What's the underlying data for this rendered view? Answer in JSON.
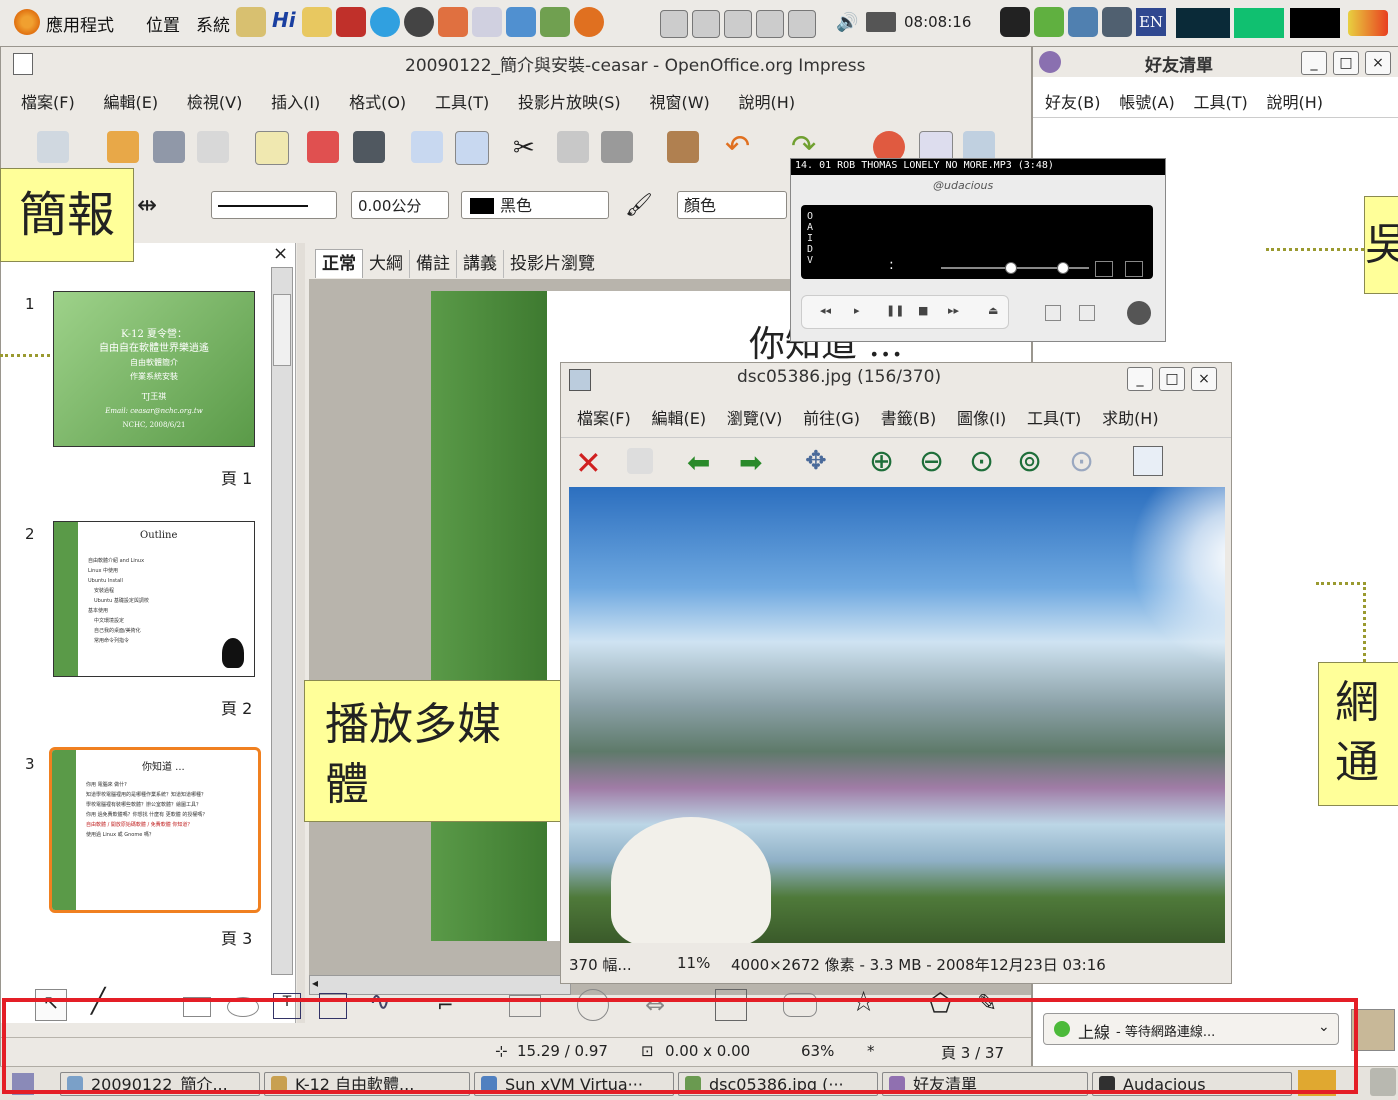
{
  "topbar": {
    "menus": [
      "應用程式",
      "位置",
      "系統"
    ],
    "clock": "08:08:16",
    "lang_badge": "EN"
  },
  "impress": {
    "title": "20090122_簡介與安裝-ceasar - OpenOffice.org Impress",
    "menus": [
      "檔案(F)",
      "編輯(E)",
      "檢視(V)",
      "插入(I)",
      "格式(O)",
      "工具(T)",
      "投影片放映(S)",
      "視窗(W)",
      "說明(H)"
    ],
    "line_width": "0.00公分",
    "line_color": "黑色",
    "fill_label": "顏色",
    "tabs": [
      "正常",
      "大綱",
      "備註",
      "講義",
      "投影片瀏覽"
    ],
    "slide_heading": "你知道 ...",
    "slides": [
      {
        "num": "1",
        "page": "頁 1",
        "title": "K-12 夏令營：",
        "subtitle": "自由自在軟體世界樂逍遙",
        "line3": "自由軟體簡介",
        "line4": "作業系統安裝",
        "author": "TJ王祺",
        "email": "Email: ceasar@nchc.org.tw",
        "org": "NCHC, 2008/6/21"
      },
      {
        "num": "2",
        "page": "頁 2",
        "title": "Outline",
        "bullets": [
          "自由軟體介紹 and Linux",
          "Linux 中使用",
          "Ubuntu Install",
          "安裝過程",
          "Ubuntu 基礎設定與調校",
          "基本使用",
          "中文環境設定",
          "自己我的桌面/美術化",
          "常用命令列指令"
        ]
      },
      {
        "num": "3",
        "page": "頁 3",
        "title": "你知道 ...",
        "bullets": [
          "你用 電腦來 做什?",
          "知道學校電腦裡用的是哪種作業系統？知道知道哪種？",
          "學校電腦裡有裝哪些軟體？辦公室軟體？繪圖工具？",
          "你用 過免費軟體嗎？你想找 什麼有 更軟體 的授權嗎？",
          "自由軟體 / 開放原始碼軟體 / 免費軟體 你知道？",
          "使用過 Linux 或 Gnome 嗎？"
        ]
      }
    ],
    "status": {
      "position": "15.29 / 0.97",
      "size": "0.00 x 0.00",
      "zoom": "63%",
      "modified": "*",
      "page": "頁 3 / 37"
    }
  },
  "callouts": {
    "left": "簡報",
    "media": "播放多媒體",
    "media_line1": "播放多媒",
    "media_line2": "體",
    "right_top": "吳",
    "right_bottom_1": "網",
    "right_bottom_2": "通"
  },
  "viewer": {
    "title": "dsc05386.jpg  (156/370)",
    "menus": [
      "檔案(F)",
      "編輯(E)",
      "瀏覽(V)",
      "前往(G)",
      "書籤(B)",
      "圖像(I)",
      "工具(T)",
      "求助(H)"
    ],
    "status": {
      "count": "370 幅...",
      "zoom": "11%",
      "info": "4000×2672 像素 - 3.3 MB - 2008年12月23日 03:16"
    }
  },
  "buddy": {
    "title": "好友清單",
    "menus": [
      "好友(B)",
      "帳號(A)",
      "工具(T)",
      "說明(H)"
    ],
    "status_label": "上線",
    "status_detail": "- 等待網路連線..."
  },
  "audacious": {
    "track": "14. 01 ROB THOMAS LONELY NO MORE.MP3 (3:48)",
    "logo": "@udacious",
    "vis_label": "OAIDV",
    "time": ":"
  },
  "taskbar": [
    {
      "label": "20090122_簡介...",
      "color": "#7aa0c8"
    },
    {
      "label": "K-12 自由軟體...",
      "color": "#c8a050"
    },
    {
      "label": "Sun xVM Virtua···",
      "color": "#5080c0"
    },
    {
      "label": "dsc05386.jpg (···",
      "color": "#6a9a50"
    },
    {
      "label": "好友清單",
      "color": "#9070b0"
    },
    {
      "label": "Audacious",
      "color": "#303030"
    }
  ],
  "colors": {
    "highlight": "#e41e26",
    "callout": "#ffff99",
    "slide_green": "#5a9a48"
  }
}
